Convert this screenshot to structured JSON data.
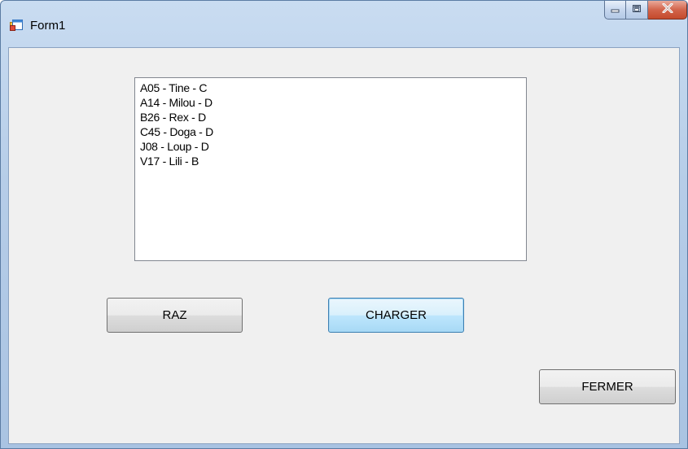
{
  "window": {
    "title": "Form1",
    "icon": "form-window-icon"
  },
  "caption_buttons": {
    "minimize_icon": "minimize-icon",
    "maximize_icon": "maximize-icon",
    "close_icon": "close-icon",
    "close_color": "#c44a2c"
  },
  "listbox": {
    "items": [
      "A05 - Tine - C",
      "A14 - Milou - D",
      "B26 - Rex - D",
      "C45 - Doga - D",
      "J08 - Loup - D",
      "V17 - Lili - B"
    ]
  },
  "buttons": {
    "raz": "RAZ",
    "charger": "CHARGER",
    "fermer": "FERMER"
  }
}
